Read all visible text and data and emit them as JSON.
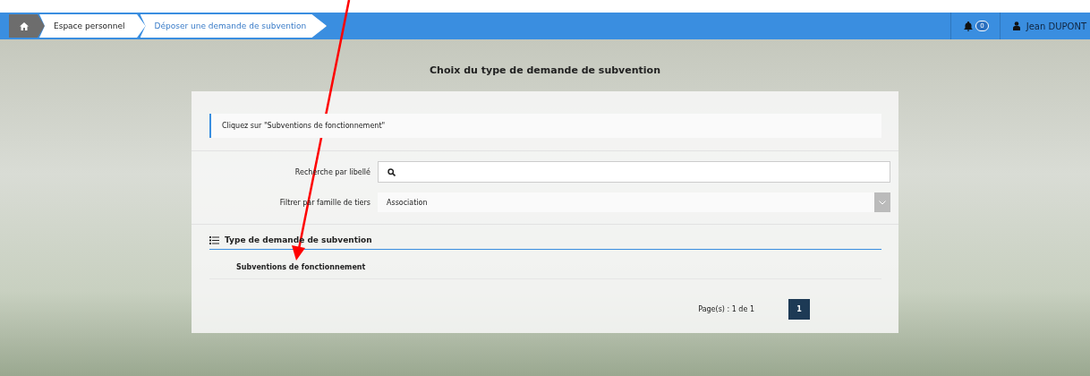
{
  "breadcrumb": [
    {
      "label": "Espace personnel",
      "selected": false
    },
    {
      "label": "Déposer une demande de subvention",
      "selected": true
    }
  ],
  "notifications": {
    "count": "0"
  },
  "user": {
    "name": "Jean DUPONT"
  },
  "page_title": "Choix du type de demande de subvention",
  "hint": "Cliquez sur \"Subventions de fonctionnement\"",
  "filters": [
    {
      "kind": "search",
      "label": "Recherche par libellé"
    },
    {
      "kind": "select",
      "label": "Filtrer par famille de tiers",
      "value": "Association"
    }
  ],
  "section": {
    "title": "Type de demande de subvention",
    "items": [
      "Subventions de fonctionnement"
    ]
  },
  "pager": {
    "summary": "Page(s) : 1 de 1",
    "pages": [
      {
        "label": "1",
        "selected": true
      }
    ]
  }
}
